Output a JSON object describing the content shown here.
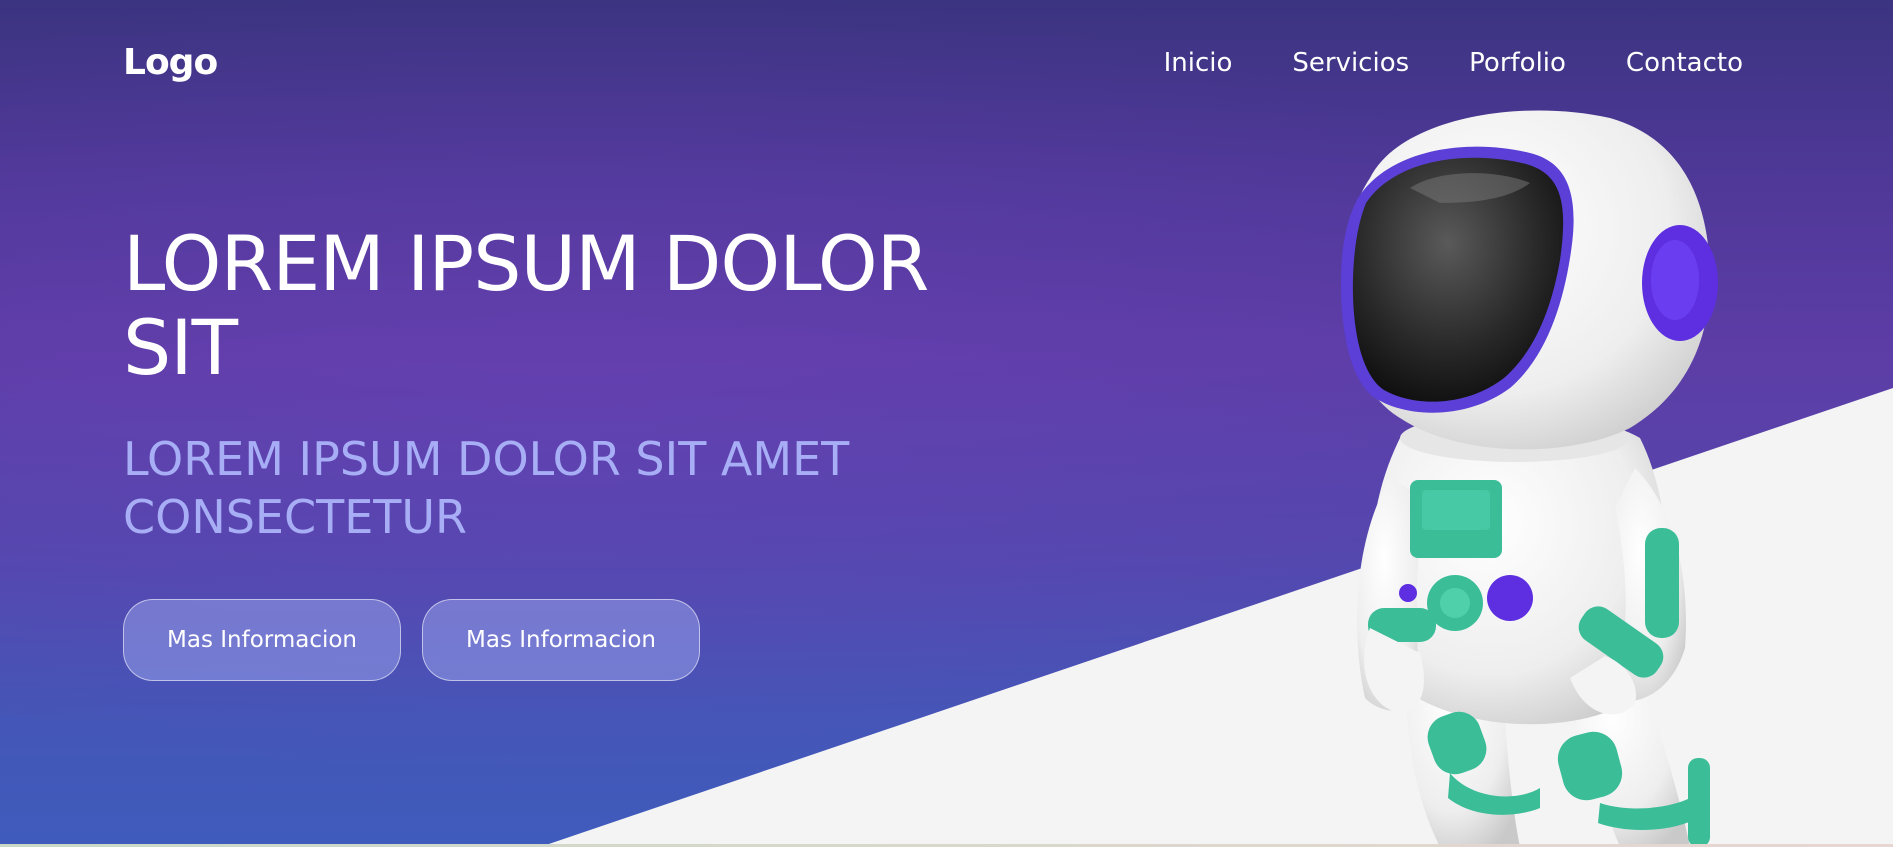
{
  "header": {
    "logo": "Logo",
    "nav": [
      {
        "label": "Inicio"
      },
      {
        "label": "Servicios"
      },
      {
        "label": "Porfolio"
      },
      {
        "label": "Contacto"
      }
    ]
  },
  "hero": {
    "title": "LOREM IPSUM DOLOR SIT",
    "subtitle": "LOREM IPSUM DOLOR SIT AMET CONSECTETUR",
    "buttons": [
      {
        "label": "Mas Informacion"
      },
      {
        "label": "Mas Informacion"
      }
    ]
  },
  "colors": {
    "gradient_top": "#3b3480",
    "gradient_mid": "#5d3da6",
    "gradient_bottom": "#3f5cbc",
    "subtitle": "#a8aef5",
    "light_panel": "#f4f4f4",
    "astronaut_accent_green": "#3bbd98",
    "astronaut_accent_purple": "#5d2fe0"
  },
  "illustration": {
    "icon": "astronaut-icon"
  }
}
